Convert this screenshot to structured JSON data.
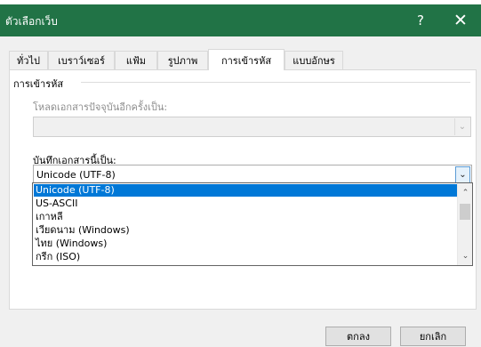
{
  "window": {
    "title": "ตัวเลือกเว็บ",
    "help_glyph": "?",
    "close_glyph": "✕"
  },
  "tabs": [
    {
      "label": "ทั่วไป",
      "active": false
    },
    {
      "label": "เบราว์เซอร์",
      "active": false
    },
    {
      "label": "แฟ้ม",
      "active": false
    },
    {
      "label": "รูปภาพ",
      "active": false
    },
    {
      "label": "การเข้ารหัส",
      "active": true
    },
    {
      "label": "แบบอักษร",
      "active": false
    }
  ],
  "encoding_group": {
    "title": "การเข้ารหัส",
    "load_label": "โหลดเอกสารปัจจุบันอีกครั้งเป็น:",
    "load_value": "",
    "save_label": "บันทึกเอกสารนี้เป็น:",
    "save_value": "Unicode (UTF-8)",
    "options": [
      "Unicode (UTF-8)",
      "US-ASCII",
      "เกาหลี",
      "เวียดนาม (Windows)",
      "ไทย (Windows)",
      "กรีก (ISO)"
    ],
    "selected_index": 0
  },
  "buttons": {
    "ok": "ตกลง",
    "cancel": "ยกเลิก"
  },
  "colors": {
    "titlebar": "#217346",
    "selection": "#0078d7"
  }
}
